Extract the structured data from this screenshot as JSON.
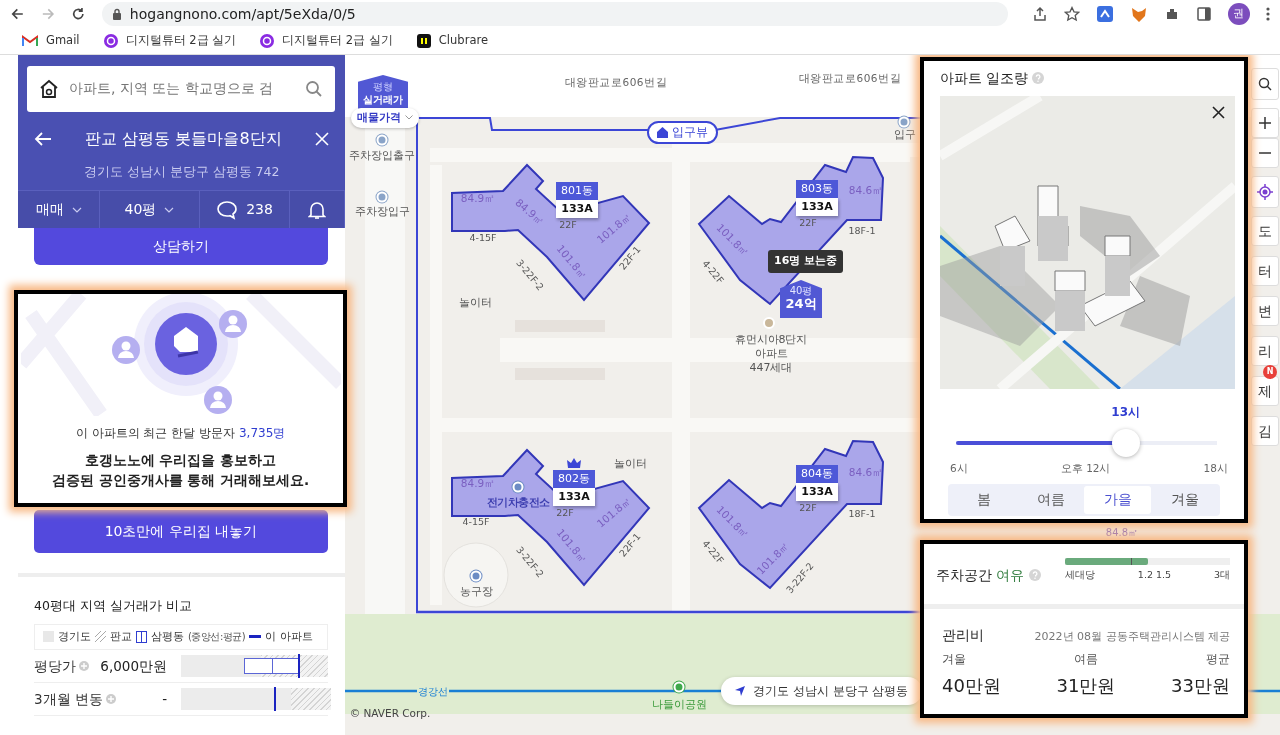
{
  "browser": {
    "nav": [
      {
        "kind": "back",
        "disabled": false
      },
      {
        "kind": "forward",
        "disabled": true
      },
      {
        "kind": "reload",
        "disabled": false
      }
    ],
    "url": "hogangnono.com/apt/5eXda/0/5",
    "profile": "권",
    "bookmarks": [
      {
        "kind": "gmail",
        "label": "Gmail"
      },
      {
        "kind": "tutor",
        "label": "디지털튜터 2급 실기"
      },
      {
        "kind": "tutor",
        "label": "디지털튜터 2급 실기"
      },
      {
        "kind": "clubrare",
        "label": "Clubrare"
      }
    ]
  },
  "sidebar": {
    "search": {
      "placeholder": "아파트, 지역 또는 학교명으로 검"
    },
    "title": "판교 삼평동 봇들마을8단지",
    "address": "경기도 성남시 분당구 삼평동 742",
    "filters": [
      {
        "kind": "dropdown",
        "label": "매매"
      },
      {
        "kind": "dropdown",
        "label": "40평"
      },
      {
        "kind": "comments",
        "label": "238"
      },
      {
        "kind": "alert"
      }
    ],
    "consult_button": "상담하기",
    "promo": {
      "visitors_label": "이 아파트의 최근 한달 방문자",
      "visitors_count": "3,735명",
      "message": [
        "호갱노노에 우리집을 홍보하고",
        "검증된 공인중개사를 통해 거래해보세요."
      ]
    },
    "list_button": "10초만에 우리집 내놓기",
    "comparison": {
      "title": "40평대 지역 실거래가 비교",
      "legend": [
        {
          "kind": "solid",
          "label": "경기도"
        },
        {
          "kind": "hatched",
          "label": "판교"
        },
        {
          "kind": "bracket",
          "label": "삼평동",
          "note": "(중앙선:평균)"
        },
        {
          "kind": "line",
          "label": "이 아파트"
        }
      ],
      "rows": [
        {
          "label": "평당가",
          "value": "6,000만원",
          "level": 0.8
        },
        {
          "label": "3개월 변동",
          "value": "-",
          "level": 0.64
        }
      ]
    }
  },
  "map": {
    "price_mode": {
      "top": "평형",
      "bottom": "실거래가",
      "dropdown": "매물가격"
    },
    "roads": [
      "대왕판교로606번길",
      "대왕판교로606번길"
    ],
    "entrance_view": "입구뷰",
    "pois": [
      {
        "kind": "parking",
        "label": "주차장입출구"
      },
      {
        "kind": "parking",
        "label": "주차장입구"
      },
      {
        "kind": "entrance",
        "label": "입구"
      },
      {
        "kind": "playground",
        "label": "놀이터"
      },
      {
        "kind": "playground",
        "label": "놀이터"
      },
      {
        "kind": "court",
        "label": "농구장"
      },
      {
        "kind": "charger",
        "label": "전기차충전소"
      },
      {
        "kind": "park",
        "label": "나들이공원"
      },
      {
        "kind": "rail",
        "label": "경강선"
      }
    ],
    "buildings": [
      {
        "name": "801동",
        "unit": "133A",
        "floor": "22F",
        "top_rank": false,
        "areas": [
          "84.9㎡",
          "84.9㎡",
          "101.8㎡",
          "101.8㎡"
        ],
        "floors": [
          "4-15F",
          "3-22F-2",
          "22F-1"
        ]
      },
      {
        "name": "803동",
        "unit": "133A",
        "floor": "22F",
        "top_rank": false,
        "areas": [
          "84.6㎡",
          "101.8㎡"
        ],
        "floors": [
          "4-22F",
          "18F-1"
        ]
      },
      {
        "name": "802동",
        "unit": "133A",
        "floor": "22F",
        "top_rank": true,
        "areas": [
          "84.9㎡",
          "101.8㎡",
          "101.8㎡"
        ],
        "floors": [
          "4-15F",
          "3-22F-2",
          "22F-1"
        ]
      },
      {
        "name": "804동",
        "unit": "133A",
        "floor": "22F",
        "top_rank": false,
        "areas": [
          "84.6㎡",
          "101.8㎡",
          "101.8㎡"
        ],
        "floors": [
          "4-22F",
          "18F-1",
          "3-22F-2"
        ]
      }
    ],
    "viewers": "16명 보는중",
    "price_marker": {
      "size": "40평",
      "price": "24억"
    },
    "complex_label": [
      "휴먼시아8단지",
      "아파트",
      "447세대"
    ],
    "extra_areas": [
      "84.8㎡"
    ],
    "location": "경기도 성남시 분당구 삼평동",
    "copyright": "© NAVER Corp."
  },
  "map_tools": [
    {
      "kind": "search"
    },
    {
      "kind": "zoom_in"
    },
    {
      "kind": "zoom_out"
    },
    {
      "kind": "locate"
    },
    {
      "kind": "text",
      "label": "도"
    },
    {
      "kind": "text",
      "label": "터"
    },
    {
      "kind": "text",
      "label": "변"
    },
    {
      "kind": "text",
      "label": "리"
    },
    {
      "kind": "text",
      "label": "제",
      "badge": "N"
    },
    {
      "kind": "text",
      "label": "김"
    }
  ],
  "sunlight": {
    "title": "아파트 일조량",
    "time": "13시",
    "level": 0.65,
    "ticks": [
      "6시",
      "오후 12시",
      "18시"
    ],
    "seasons": [
      {
        "label": "봄",
        "selected": false
      },
      {
        "label": "여름",
        "selected": false
      },
      {
        "label": "가을",
        "selected": true
      },
      {
        "label": "겨울",
        "selected": false
      }
    ]
  },
  "parking": {
    "title": "주차공간",
    "status": "여유",
    "level": 0.5,
    "labels": [
      "세대당",
      "1.2 1.5",
      "3대"
    ]
  },
  "fees": {
    "title": "관리비",
    "source": "2022년 08월 공동주택관리시스템 제공",
    "columns": [
      {
        "label": "겨울",
        "value": "40만원"
      },
      {
        "label": "여름",
        "value": "31만원"
      },
      {
        "label": "평균",
        "value": "33만원"
      }
    ]
  }
}
